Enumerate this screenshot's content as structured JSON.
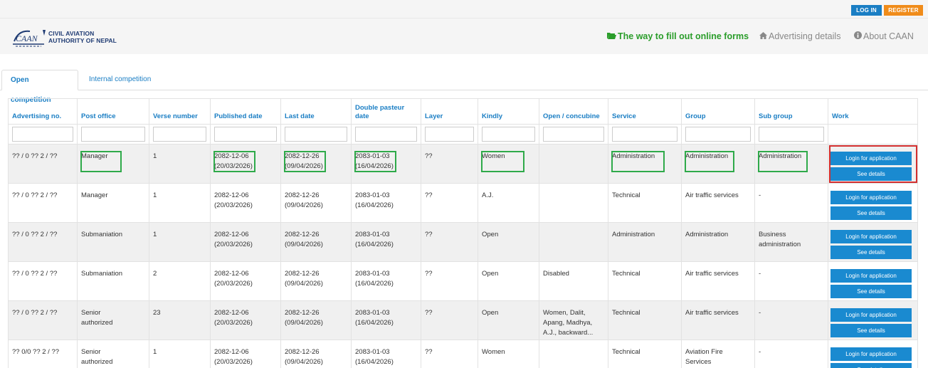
{
  "topbar": {
    "login_label": "LOG IN",
    "register_label": "REGISTER"
  },
  "header": {
    "logo_line1": "CIVIL AVIATION",
    "logo_line2": "AUTHORITY OF NEPAL",
    "nav": [
      {
        "label": "The way to fill out online forms",
        "icon": "folder-open-icon"
      },
      {
        "label": "Advertising details",
        "icon": "home-icon"
      },
      {
        "label": "About CAAN",
        "icon": "info-circle-icon"
      }
    ]
  },
  "tabs": [
    {
      "label": "Open competition",
      "active": true
    },
    {
      "label": "Internal competition",
      "active": false
    }
  ],
  "table": {
    "columns": [
      "Advertising no.",
      "Post office",
      "Verse number",
      "Published date",
      "Last date",
      "Double pasteur date",
      "Layer",
      "Kindly",
      "Open / concubine",
      "Service",
      "Group",
      "Sub group",
      "Work"
    ],
    "rows": [
      {
        "adv": "?? / 0 ?? 2 / ??",
        "post": "Manager",
        "verse": "1",
        "pub1": "2082-12-06",
        "pub2": "(20/03/2026)",
        "last1": "2082-12-26",
        "last2": "(09/04/2026)",
        "dbl1": "2083-01-03",
        "dbl2": "(16/04/2026)",
        "layer": "??",
        "kindly": "Women",
        "open": "",
        "service": "Administration",
        "group": "Administration",
        "subgroup": "Administration"
      },
      {
        "adv": "?? / 0 ?? 2 / ??",
        "post": "Manager",
        "verse": "1",
        "pub1": "2082-12-06",
        "pub2": "(20/03/2026)",
        "last1": "2082-12-26",
        "last2": "(09/04/2026)",
        "dbl1": "2083-01-03",
        "dbl2": "(16/04/2026)",
        "layer": "??",
        "kindly": "A.J.",
        "open": "",
        "service": "Technical",
        "group": "Air traffic services",
        "subgroup": "-"
      },
      {
        "adv": "?? / 0 ?? 2 / ??",
        "post": "Submaniation",
        "verse": "1",
        "pub1": "2082-12-06",
        "pub2": "(20/03/2026)",
        "last1": "2082-12-26",
        "last2": "(09/04/2026)",
        "dbl1": "2083-01-03",
        "dbl2": "(16/04/2026)",
        "layer": "??",
        "kindly": "Open",
        "open": "",
        "service": "Administration",
        "group": "Administration",
        "subgroup": "Business administration"
      },
      {
        "adv": "?? / 0 ?? 2 / ??",
        "post": "Submaniation",
        "verse": "2",
        "pub1": "2082-12-06",
        "pub2": "(20/03/2026)",
        "last1": "2082-12-26",
        "last2": "(09/04/2026)",
        "dbl1": "2083-01-03",
        "dbl2": "(16/04/2026)",
        "layer": "??",
        "kindly": "Open",
        "open": "Disabled",
        "service": "Technical",
        "group": "Air traffic services",
        "subgroup": "-"
      },
      {
        "adv": "?? / 0 ?? 2 / ??",
        "post": "Senior authorized",
        "verse": "23",
        "pub1": "2082-12-06",
        "pub2": "(20/03/2026)",
        "last1": "2082-12-26",
        "last2": "(09/04/2026)",
        "dbl1": "2083-01-03",
        "dbl2": "(16/04/2026)",
        "layer": "??",
        "kindly": "Open",
        "open": "Women, Dalit, Apang, Madhya, A.J., backward...",
        "service": "Technical",
        "group": "Air traffic services",
        "subgroup": "-"
      },
      {
        "adv": "?? 0/0 ?? 2 / ??",
        "post": "Senior authorized",
        "verse": "1",
        "pub1": "2082-12-06",
        "pub2": "(20/03/2026)",
        "last1": "2082-12-26",
        "last2": "(09/04/2026)",
        "dbl1": "2083-01-03",
        "dbl2": "(16/04/2026)",
        "layer": "??",
        "kindly": "Women",
        "open": "",
        "service": "Technical",
        "group": "Aviation Fire Services",
        "subgroup": "-"
      }
    ],
    "work_buttons": {
      "apply": "Login for application",
      "details": "See details"
    }
  },
  "colors": {
    "accent": "#1a7ec4",
    "register": "#f08c1a",
    "nav_green": "#2a9d2a",
    "highlight_green": "#2faa4a",
    "highlight_red": "#d32f2f"
  }
}
